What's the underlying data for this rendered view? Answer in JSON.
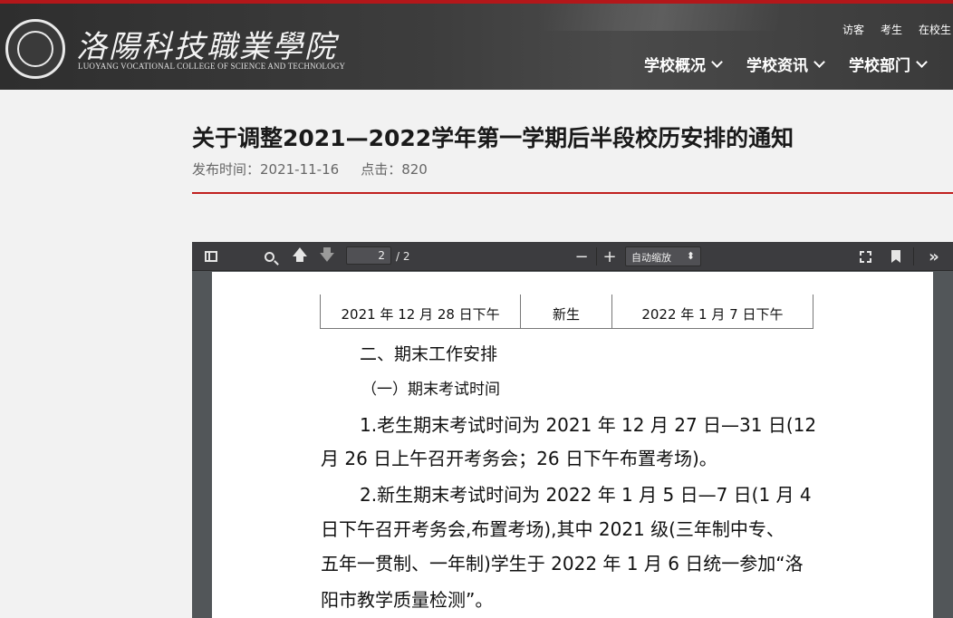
{
  "header": {
    "logo_title": "洛陽科技職業學院",
    "logo_subtitle": "LUOYANG VOCATIONAL COLLEGE OF SCIENCE AND TECHNOLOGY",
    "quick_links": [
      "访客",
      "考生",
      "在校生"
    ],
    "nav": [
      "学校概况",
      "学校资讯",
      "学校部门"
    ]
  },
  "article": {
    "title": "关于调整2021—2022学年第一学期后半段校历安排的通知",
    "publish_label": "发布时间：2021-11-16",
    "clicks_label": "点击：820"
  },
  "viewer": {
    "page_current": "2",
    "page_total": "/ 2",
    "zoom": "自动缩放",
    "zoom_arrow": "⬍",
    "icons": [
      "sidebar-toggle-icon",
      "search-icon",
      "arrow-up-icon",
      "arrow-down-icon",
      "minus-icon",
      "plus-icon",
      "fullscreen-icon",
      "bookmark-icon",
      "double-chevron-icon"
    ]
  },
  "pdf": {
    "table_row": [
      "2021 年 12 月 28 日下午",
      "新生",
      "2022 年 1 月 7 日下午"
    ],
    "heading": "二、期末工作安排",
    "subheading": "（一）期末考试时间",
    "lines": [
      "1.老生期末考试时间为 2021 年 12 月 27 日—31 日(12",
      "月 26 日上午召开考务会；26 日下午布置考场)。",
      "2.新生期末考试时间为 2022 年 1 月 5 日—7 日(1 月 4",
      "日下午召开考务会,布置考场),其中 2021 级(三年制中专、",
      "五年一贯制、一年制)学生于 2022 年 1 月 6 日统一参加“洛",
      "阳市教学质量检测”。"
    ]
  }
}
